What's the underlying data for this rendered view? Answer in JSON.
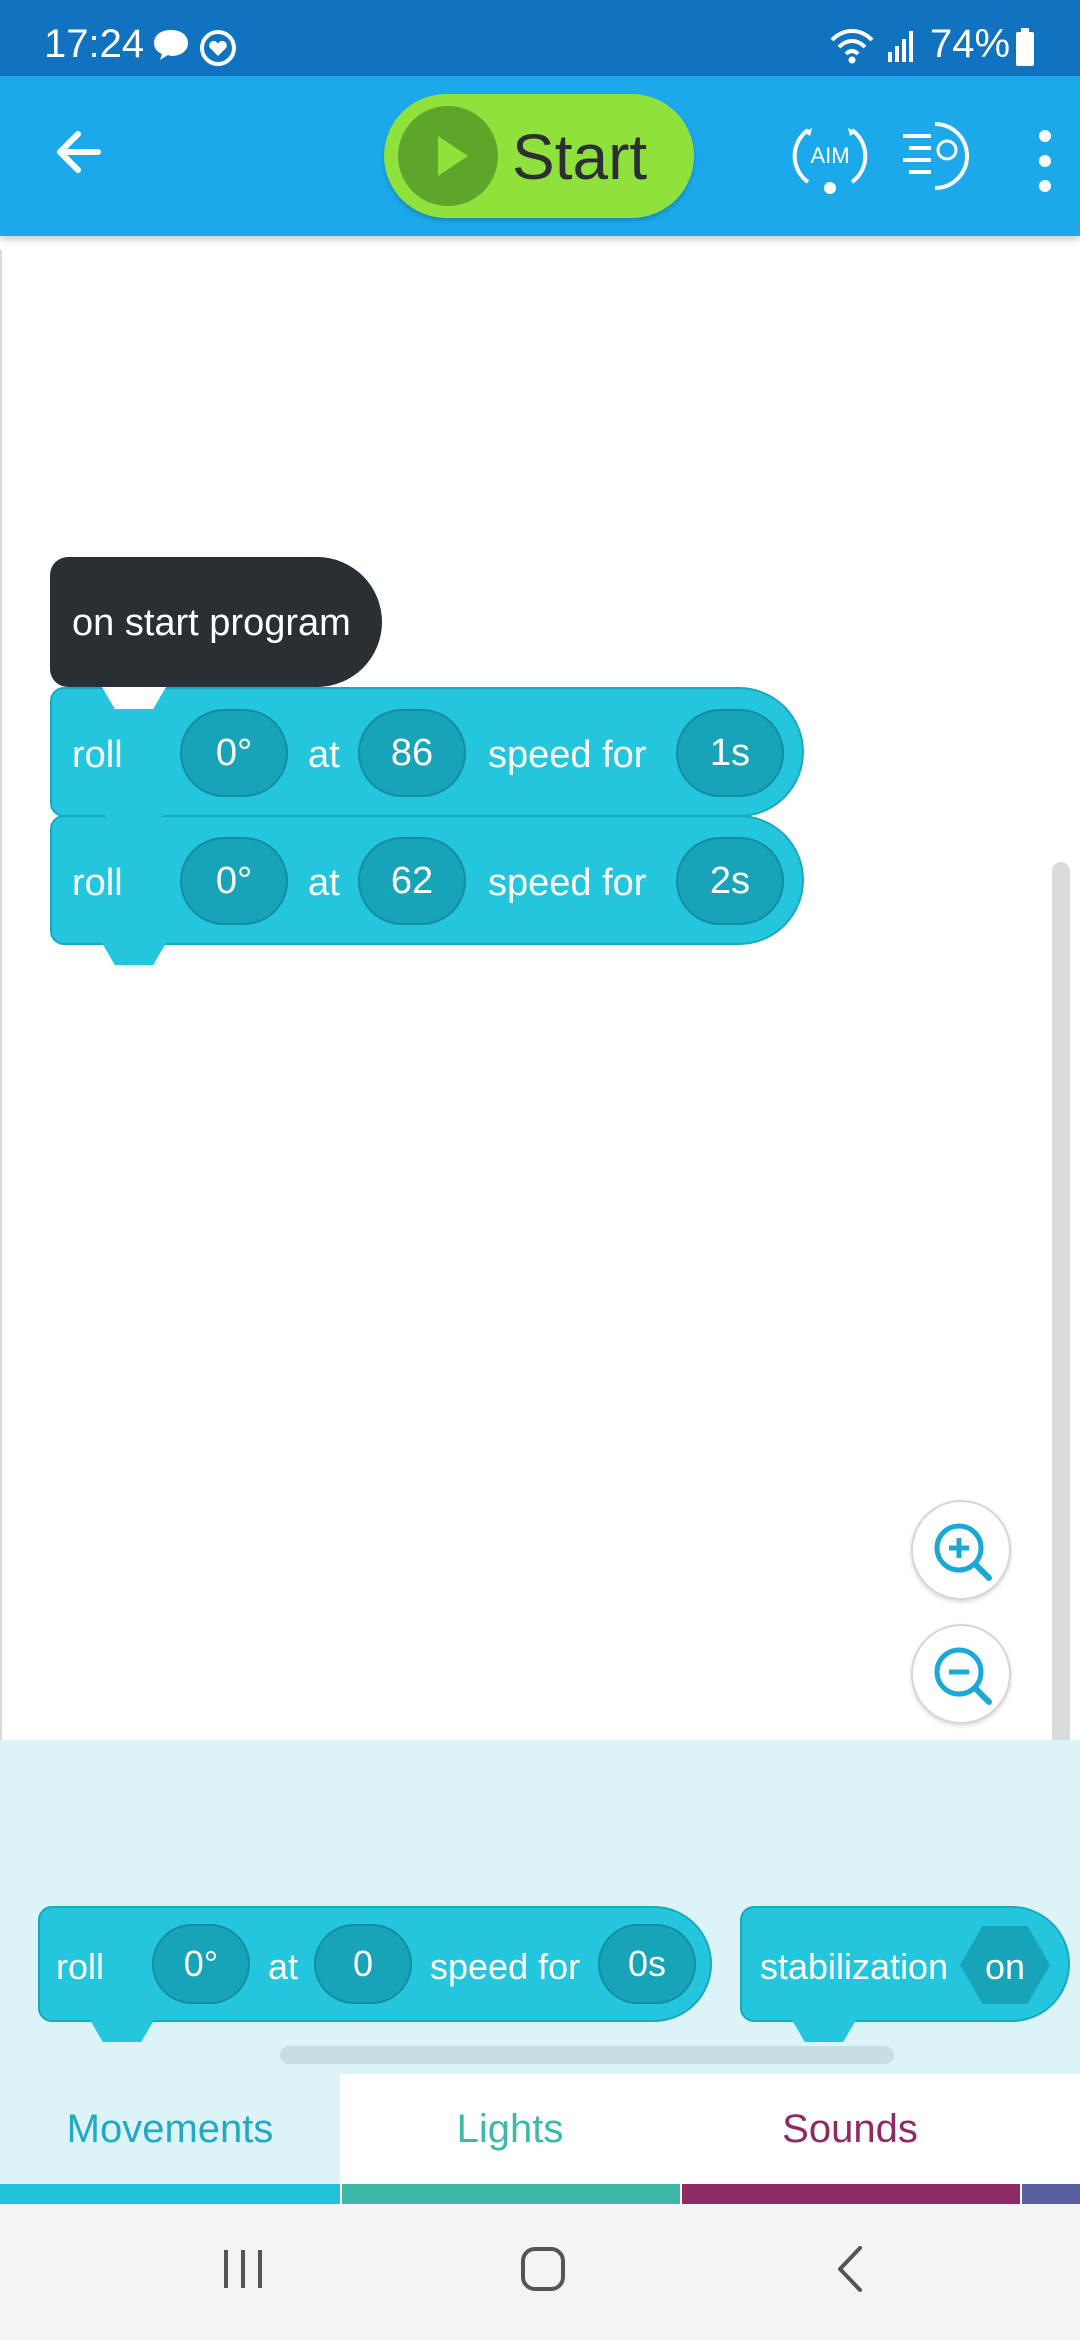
{
  "status_bar": {
    "time": "17:24",
    "battery": "74%",
    "icons": [
      "chat-bubble-icon",
      "heart-sync-icon",
      "wifi-icon",
      "signal-icon",
      "battery-icon"
    ]
  },
  "app_bar": {
    "start_label": "Start",
    "aim_label": "AIM",
    "icons": [
      "back-arrow-icon",
      "play-icon",
      "aim-icon",
      "drive-icon",
      "more-vert-icon"
    ]
  },
  "program": {
    "hat_label": "on start program",
    "blocks": [
      {
        "verb": "roll",
        "heading": "0°",
        "at": "at",
        "speed": "86",
        "speed_for": "speed for",
        "duration": "1s"
      },
      {
        "verb": "roll",
        "heading": "0°",
        "at": "at",
        "speed": "62",
        "speed_for": "speed for",
        "duration": "2s"
      }
    ]
  },
  "palette": {
    "roll_block": {
      "verb": "roll",
      "heading": "0°",
      "at": "at",
      "speed": "0",
      "speed_for": "speed for",
      "duration": "0s"
    },
    "stabilization_block": {
      "label": "stabilization",
      "value": "on"
    }
  },
  "tabs": [
    {
      "label": "Movements",
      "color": "#21a9c6",
      "active": true
    },
    {
      "label": "Lights",
      "color": "#3eb8a8",
      "active": false
    },
    {
      "label": "Sounds",
      "color": "#8e2a64",
      "active": false
    }
  ],
  "colors": {
    "status_bar": "#1173c0",
    "app_bar": "#1ca9ec",
    "start_button": "#8fe13b",
    "movement_block": "#23c6dc",
    "hat_block": "#2a2f34",
    "palette_bg": "#dcf3f7"
  }
}
